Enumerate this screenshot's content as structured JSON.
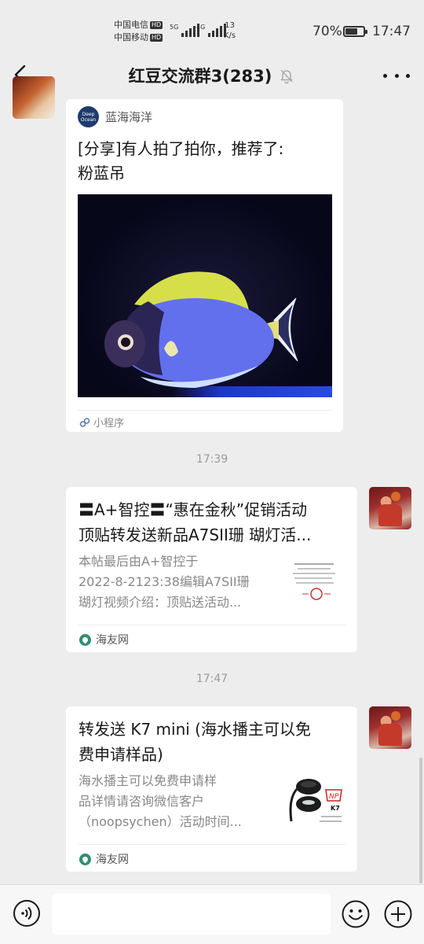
{
  "status_bar": {
    "carrier_1": "中国电信",
    "carrier_2": "中国移动",
    "hd_badge": "HD",
    "signal_1_tag": "5G",
    "signal_2_tag": "4G",
    "net_speed_value": "13",
    "net_speed_unit": "K/s",
    "battery_percent": "70%",
    "battery_level": 0.7,
    "time": "17:47"
  },
  "header": {
    "title": "红豆交流群3(283)",
    "back_icon": "chevron-left-icon",
    "mute_icon": "bell-off-icon",
    "more_icon": "more-dots-icon"
  },
  "messages": {
    "mini_program": {
      "source_name": "蓝海海洋",
      "logo_text": "Deep Ocean",
      "title_lines": [
        "[分享]有人拍了拍你，推荐了:",
        "粉蓝吊"
      ],
      "footer_label": "小程序"
    },
    "time_1": "17:39",
    "link_1": {
      "title_lines": [
        "〓A+智控〓“惠在金秋”促销活动",
        "顶贴转发送新品A7SII珊 瑚灯活..."
      ],
      "desc_lines": [
        "本帖最后由A+智控于",
        "2022-8-2123:38编辑A7SII珊",
        "瑚灯视频介绍：顶贴送活动..."
      ],
      "source": "海友网"
    },
    "time_2": "17:47",
    "link_2": {
      "title_lines": [
        "转发送 K7 mini (海水播主可以免",
        "费申请样品)"
      ],
      "desc_lines": [
        "海水播主可以免费申请样",
        "品详情请咨询微信客户",
        "（noopsychen）活动时间..."
      ],
      "source": "海友网",
      "thumb_caption": "K7"
    }
  },
  "input_bar": {
    "placeholder": "",
    "voice_icon": "voice-icon",
    "emoji_icon": "emoji-icon",
    "plus_icon": "plus-circle-icon"
  }
}
